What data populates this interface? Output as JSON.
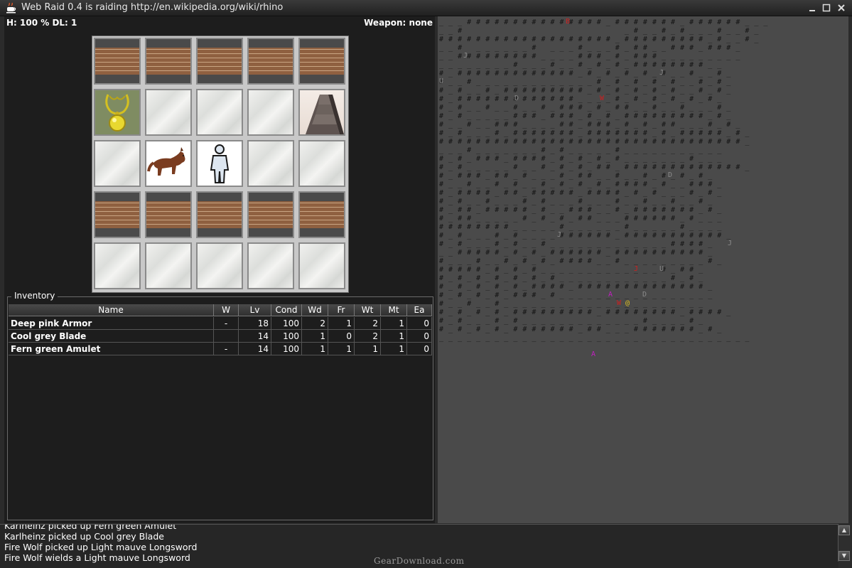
{
  "window": {
    "title": "Web Raid 0.4 is raiding http://en.wikipedia.org/wiki/rhino",
    "controls": [
      "minimize",
      "maximize",
      "close"
    ]
  },
  "status": {
    "health": "H: 100 %  DL: 1",
    "weapon": "Weapon: none"
  },
  "room_grid": [
    [
      "brick",
      "brick",
      "brick",
      "brick",
      "brick"
    ],
    [
      "amulet",
      "marble",
      "marble",
      "marble",
      "stairs"
    ],
    [
      "marble",
      "wolf",
      "player",
      "marble",
      "marble"
    ],
    [
      "brick",
      "brick",
      "brick",
      "brick",
      "brick"
    ],
    [
      "marble",
      "marble",
      "marble",
      "marble",
      "marble"
    ]
  ],
  "inventory": {
    "legend": "Inventory",
    "columns": [
      "Name",
      "W",
      "Lv",
      "Cond",
      "Wd",
      "Fr",
      "Wt",
      "Mt",
      "Ea"
    ],
    "rows": [
      [
        "Deep pink Armor",
        "-",
        "18",
        "100",
        "2",
        "1",
        "2",
        "1",
        "0"
      ],
      [
        "Cool grey Blade",
        "",
        "14",
        "100",
        "1",
        "0",
        "2",
        "1",
        "0"
      ],
      [
        "Fern green Amulet",
        "-",
        "14",
        "100",
        "1",
        "1",
        "1",
        "1",
        "0"
      ]
    ]
  },
  "map": {
    "rows": [
      "_ _ _ # # # # # # # # # # # # # # # _ # # # # # # # _ # # # # # # _ _ _",
      "_ _ #                                   _ # _ _ # _ # _ _ _ # _ _ # _",
      "# # # # # # # # # # # # # # # # # # # _ # # # # # # # # # _ # _ _ # _",
      "_ _ #   _ _ _ _ _ _ #   _ _ _ # _ _ _ # _ # # _ _ # # # _ # # # _",
      "_ _ # # # # # # # # # _ _ _ _ # # # _ # _ # # # _ _ _ _ _ _ _ _ _",
      "_ _ _ _ _ _ _ _ # _ _ _ # _ _ # _ # _ # _ # # # # # # # # _ _",
      "# _ # # # # # # # # # # # # # _ # _ # _ # _ # _ # _ _ # _ _ # _",
      "# _ _ # _ _ _ _ _ _ _ _ _ _ _ _ _ # _ # _ # _ # _ # _ _ # _ # _",
      "# _ # _ _ # _ # # # # # # # # # _ # _ # _ # _ # _ # _ _ # _ # _",
      "# _ # # # # # # # # # # # # # _ _ _ _ # _ # _ # _ # _ # _ # _",
      "# _ # _ _ # _ _ # _ _ # _ # # # _ # _ # # _ _ # _ _ # _ _ _ # _",
      "# _ # _ _ _ _ _ # # # _ # # # _ # _ # _ # # # # # # # # # _ # _",
      "# _ _ # _ _ # # # _ _ _ _ # # _ # # # _ # _ # _ # # _ _ _ # _ # _",
      "# _ # _ _ _ # _ # # # # # # # _ # # # # # # # _ # _ # # # # # _ # _",
      "# # # # # # # # # # # # # # # # # # # # # # # # # # # # # # # # # _",
      "_ _ _ # _ _ _ _ _ _ _ # _ # _ _ _ _ _ # _ _ _ _ _ _ _ _ _ _ _",
      "# _ # _ # # # _ # # # # _ # _ # _ # _ # _ _ _ _ _ _ _ # _ _ _",
      "# _ # _ _ _ _ _ # _ _ # _ # _ # _ # # _ # # # # # # # # # # # # # _",
      "# _ # # # _ # # _ # _ _ _ # _ # # _ _ # _ _ # _ # _ # _ # _",
      "# _ _ # _ _ # _ # _ _ # _ # _ # _ # _ # # # # _ # _ _ # # # _",
      "# _ # # # # _ # # _ # # # # # _ # # # # _ # _ # _ _ _ # _ # _",
      "# _ # _ _ # _ _ _ # _ # _ _ _ # _ _ _ # _ _ # _ _ # _ _ # _",
      "# _ # # _ # # # # # _ # _ _ # # # _ _ # _ # # # # # # # _ # _",
      "# _ # # _ _ _ _ _ # _ # _ # _ # # _ _ _ # # # # # # _ # _ _ _",
      "# # # # # # # # _ _ _ _ _ # _ _ _ _ _ _ # _ _ _ _ _ # _ _ _ _",
      "# _ # _ _ _ # _ # _ _ _ _ # # # # # # _ # # # # # # # # # # # _",
      "# _ # _ _ _ # _ # _ _ # _ _ _ _ _ _ _ _ _ _ _ _ _ # # # # _",
      "_ _ # # # # # _ # _ # _ # # # # # # _ # # # # # # # # # # _",
      "# _ _ _ # _ _ # _ # _ # _ # # # # _ _ # _ _ _ _ _ _ _ _ _ # _",
      "# # # # # _ # _ # _ # _ _ _ _ _ _ _ _ _ _ _ _ _ # _ # # _",
      "# _ # _ # _ # _ # _ # _ # _ _ _ _ _ _ _ _ _ _ _ _ # _ # _",
      "# _ # _ # _ # _ # _ # # # # _ # # # # # # # # # # # # # # _",
      "# _ # _ # _ # _ # # # _ # _ _ _ _ _ _ _ _ _ _ _ _ _ _ _ _ _",
      "# _ _ # _ _ # _ _ _ _ _ _ _ _ _ _ _ _ _ _ _ _ _ _ _ _ _ _",
      "# _ # _ # _ # _ # # # # # # # # # _ # # # # # # # # _ # # # # _",
      "# _ # _ _ _ # _ # _ _ _ _ _ _ _ _ _ _ _ _ _ # _ _ _ _ # _",
      "# _ # _ # _ # _ # # # # # # # _ # # _ _ _ # # # # # # # _ # _",
      "_ _ _ _ _ _ _ _ _ _ _ _ _ _ _ _ _ _ _ _ _ _ _ _ _ _ _ _ _ _ _ _ _ _"
    ],
    "monsters": [
      {
        "glyph": "B",
        "color": "#cc2020"
      },
      {
        "glyph": "J",
        "color": "#8a8a8a"
      },
      {
        "glyph": "U",
        "color": "#8a8a8a"
      },
      {
        "glyph": "J",
        "color": "#8a8a8a"
      },
      {
        "glyph": "D",
        "color": "#8a8a8a"
      },
      {
        "glyph": "W",
        "color": "#cc2020"
      },
      {
        "glyph": "D",
        "color": "#8a8a8a"
      },
      {
        "glyph": "J",
        "color": "#8a8a8a"
      },
      {
        "glyph": "J",
        "color": "#8a8a8a"
      },
      {
        "glyph": "J",
        "color": "#cc2020"
      },
      {
        "glyph": "U",
        "color": "#8a8a8a"
      },
      {
        "glyph": "A",
        "color": "#c020c0"
      },
      {
        "glyph": "D",
        "color": "#8a8a8a"
      },
      {
        "glyph": "W",
        "color": "#cc2020"
      },
      {
        "glyph": "@",
        "color": "#e0c020"
      },
      {
        "glyph": "A",
        "color": "#c020c0"
      }
    ]
  },
  "log": {
    "lines": [
      "Karlheinz picked up Fern green Amulet",
      "Karlheinz picked up Cool grey Blade",
      "Fire Wolf picked up Light mauve Longsword",
      "Fire Wolf wields a Light mauve Longsword"
    ]
  },
  "watermark": "GearDownload.com",
  "colors": {
    "background": "#2b2b2b",
    "panel": "#1d1d1d",
    "map": "#4a4a4a"
  }
}
